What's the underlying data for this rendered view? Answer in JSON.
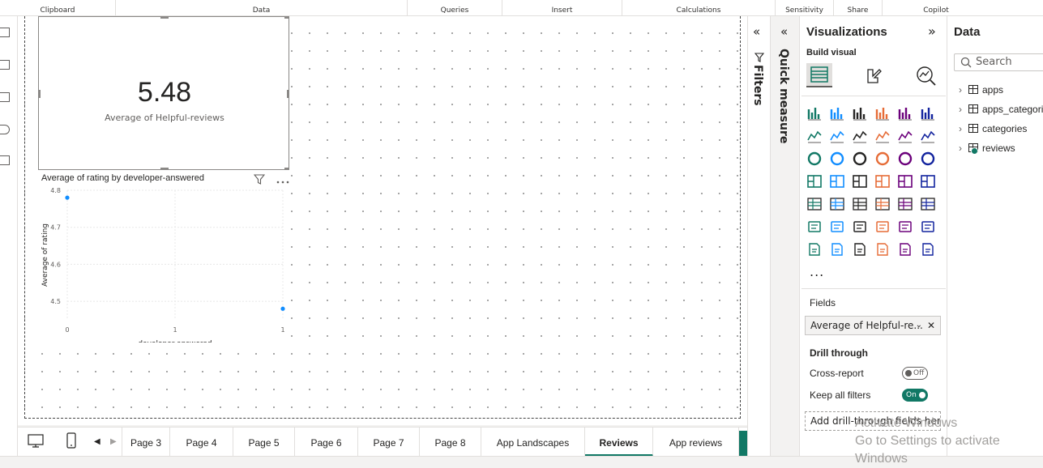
{
  "ribbon": {
    "groups": [
      "Clipboard",
      "Data",
      "Queries",
      "Insert",
      "Calculations",
      "Sensitivity",
      "Share",
      "Copilot"
    ]
  },
  "card": {
    "value": "5.48",
    "label": "Average of Helpful-reviews"
  },
  "chart_data": {
    "type": "scatter",
    "title": "Average of rating by developer-answered",
    "xlabel": "developer-answered",
    "ylabel": "Average of rating",
    "x_ticks": [
      "0",
      "1",
      "1"
    ],
    "y_ticks": [
      "4.8",
      "4.7",
      "4.6",
      "4.5"
    ],
    "xlim": [
      0,
      1
    ],
    "ylim": [
      4.45,
      4.8
    ],
    "grid": true,
    "series": [
      {
        "points": [
          {
            "x": 0,
            "y": 4.78
          },
          {
            "x": 1,
            "y": 4.48
          }
        ],
        "color": "#118dff"
      }
    ]
  },
  "tabs": {
    "items": [
      "Page 3",
      "Page 4",
      "Page 5",
      "Page 6",
      "Page 7",
      "Page 8",
      "App Landscapes",
      "Reviews",
      "App reviews"
    ],
    "active": "Reviews",
    "add": "+"
  },
  "filters": {
    "label": "Filters"
  },
  "quick_measure": {
    "label": "Quick measure"
  },
  "visualizations": {
    "title": "Visualizations",
    "build_visual": "Build visual",
    "more": "...",
    "fields_heading": "Fields",
    "field_value": "Average of Helpful-re...",
    "drill_through_heading": "Drill through",
    "cross_report_label": "Cross-report",
    "cross_report_state": "Off",
    "keep_filters_label": "Keep all filters",
    "keep_filters_state": "On",
    "add_drill_through": "Add drill-through fields here"
  },
  "data_pane": {
    "title": "Data",
    "search_placeholder": "Search",
    "tables": [
      "apps",
      "apps_categories",
      "categories",
      "reviews"
    ]
  },
  "watermark": {
    "line1": "Activate Windows",
    "line2": "Go to Settings to activate Windows"
  },
  "colors": {
    "accent": "#117865",
    "point": "#118dff"
  }
}
